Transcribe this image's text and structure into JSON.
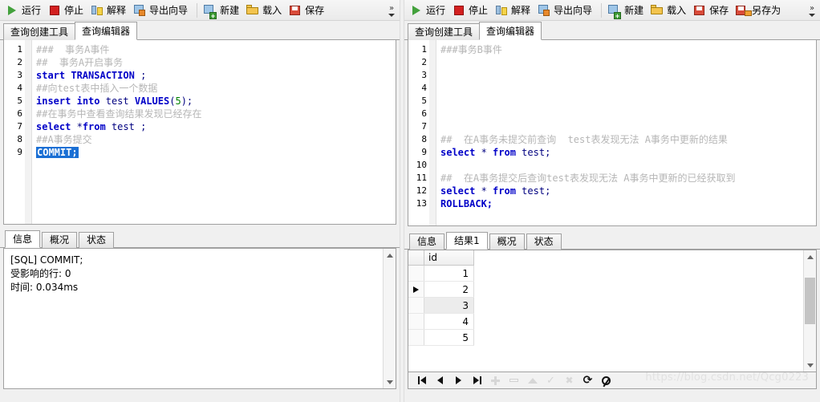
{
  "left_pane": {
    "toolbar": {
      "buttons": [
        {
          "label": "运行",
          "icon": "run-icon"
        },
        {
          "label": "停止",
          "icon": "stop-icon"
        },
        {
          "label": "解释",
          "icon": "explain-icon"
        },
        {
          "label": "导出向导",
          "icon": "export-wizard-icon"
        },
        {
          "label": "新建",
          "icon": "new-icon"
        },
        {
          "label": "载入",
          "icon": "load-folder-icon"
        },
        {
          "label": "保存",
          "icon": "save-floppy-icon"
        }
      ],
      "overflow_label": "»"
    },
    "tabs": [
      {
        "label": "查询创建工具",
        "active": false
      },
      {
        "label": "查询编辑器",
        "active": true
      }
    ],
    "editor": {
      "lines": [
        {
          "n": "1",
          "segments": [
            {
              "text": "###  事务A事件",
              "cls": "cm"
            }
          ]
        },
        {
          "n": "2",
          "segments": [
            {
              "text": "##  事务A开启事务",
              "cls": "cm"
            }
          ]
        },
        {
          "n": "3",
          "segments": [
            {
              "text": "start",
              "cls": "kw"
            },
            {
              "text": " ",
              "cls": ""
            },
            {
              "text": "TRANSACTION",
              "cls": "kw"
            },
            {
              "text": " ;",
              "cls": "id2"
            }
          ]
        },
        {
          "n": "4",
          "segments": [
            {
              "text": "##向test表中插入一个数据",
              "cls": "cm"
            }
          ]
        },
        {
          "n": "5",
          "segments": [
            {
              "text": "insert",
              "cls": "kw"
            },
            {
              "text": " ",
              "cls": ""
            },
            {
              "text": "into",
              "cls": "kw"
            },
            {
              "text": " test ",
              "cls": "id2"
            },
            {
              "text": "VALUES",
              "cls": "kw"
            },
            {
              "text": "(",
              "cls": "id2"
            },
            {
              "text": "5",
              "cls": "num"
            },
            {
              "text": ");",
              "cls": "id2"
            }
          ]
        },
        {
          "n": "6",
          "segments": [
            {
              "text": "##在事务中查看查询结果发现已经存在",
              "cls": "cm"
            }
          ]
        },
        {
          "n": "7",
          "segments": [
            {
              "text": "select",
              "cls": "kw"
            },
            {
              "text": " *",
              "cls": "id2"
            },
            {
              "text": "from",
              "cls": "kw"
            },
            {
              "text": " test ;",
              "cls": "id2"
            }
          ]
        },
        {
          "n": "8",
          "segments": [
            {
              "text": "##A事务提交",
              "cls": "cm"
            }
          ]
        },
        {
          "n": "9",
          "segments": [
            {
              "text": "COMMIT;",
              "cls": "sel"
            }
          ]
        }
      ]
    },
    "bottom_tabs": [
      {
        "label": "信息",
        "active": true
      },
      {
        "label": "概况",
        "active": false
      },
      {
        "label": "状态",
        "active": false
      }
    ],
    "info_lines": [
      "[SQL] COMMIT;",
      "受影响的行: 0",
      "时间: 0.034ms"
    ]
  },
  "right_pane": {
    "toolbar": {
      "buttons": [
        {
          "label": "运行",
          "icon": "run-icon"
        },
        {
          "label": "停止",
          "icon": "stop-icon"
        },
        {
          "label": "解释",
          "icon": "explain-icon"
        },
        {
          "label": "导出向导",
          "icon": "export-wizard-icon"
        },
        {
          "label": "新建",
          "icon": "new-icon"
        },
        {
          "label": "载入",
          "icon": "load-folder-icon"
        },
        {
          "label": "保存",
          "icon": "save-floppy-icon"
        },
        {
          "label": "另存为",
          "icon": "save-as-icon"
        }
      ],
      "overflow_label": "»"
    },
    "tabs": [
      {
        "label": "查询创建工具",
        "active": false
      },
      {
        "label": "查询编辑器",
        "active": true
      }
    ],
    "editor": {
      "lines": [
        {
          "n": "1",
          "segments": [
            {
              "text": "###事务B事件",
              "cls": "cm"
            }
          ]
        },
        {
          "n": "2",
          "segments": [
            {
              "text": "",
              "cls": ""
            }
          ]
        },
        {
          "n": "3",
          "segments": [
            {
              "text": "",
              "cls": ""
            }
          ]
        },
        {
          "n": "4",
          "segments": [
            {
              "text": "",
              "cls": ""
            }
          ]
        },
        {
          "n": "5",
          "segments": [
            {
              "text": "",
              "cls": ""
            }
          ]
        },
        {
          "n": "6",
          "segments": [
            {
              "text": "",
              "cls": ""
            }
          ]
        },
        {
          "n": "7",
          "segments": [
            {
              "text": "",
              "cls": ""
            }
          ]
        },
        {
          "n": "8",
          "segments": [
            {
              "text": "##  在A事务未提交前查询  test表发现无法 A事务中更新的结果",
              "cls": "cm"
            }
          ]
        },
        {
          "n": "9",
          "segments": [
            {
              "text": "select",
              "cls": "kw"
            },
            {
              "text": " * ",
              "cls": "id2"
            },
            {
              "text": "from",
              "cls": "kw"
            },
            {
              "text": " test;",
              "cls": "id2"
            }
          ]
        },
        {
          "n": "10",
          "segments": [
            {
              "text": "",
              "cls": ""
            }
          ]
        },
        {
          "n": "11",
          "segments": [
            {
              "text": "##  在A事务提交后查询test表发现无法 A事务中更新的已经获取到",
              "cls": "cm"
            }
          ]
        },
        {
          "n": "12",
          "segments": [
            {
              "text": "select",
              "cls": "kw"
            },
            {
              "text": " * ",
              "cls": "id2"
            },
            {
              "text": "from",
              "cls": "kw"
            },
            {
              "text": " test;",
              "cls": "id2"
            }
          ]
        },
        {
          "n": "13",
          "segments": [
            {
              "text": "ROLLBACK;",
              "cls": "kw"
            }
          ]
        }
      ]
    },
    "bottom_tabs": [
      {
        "label": "信息",
        "active": false
      },
      {
        "label": "结果1",
        "active": true
      },
      {
        "label": "概况",
        "active": false
      },
      {
        "label": "状态",
        "active": false
      }
    ],
    "result_grid": {
      "columns": [
        "id"
      ],
      "rows": [
        {
          "id": "1",
          "current": false,
          "highlighted": false
        },
        {
          "id": "2",
          "current": true,
          "highlighted": false
        },
        {
          "id": "3",
          "current": false,
          "highlighted": true
        },
        {
          "id": "4",
          "current": false,
          "highlighted": false
        },
        {
          "id": "5",
          "current": false,
          "highlighted": false
        }
      ]
    },
    "nav_buttons": [
      {
        "name": "first-record",
        "enabled": true
      },
      {
        "name": "prev-record",
        "enabled": true
      },
      {
        "name": "next-record",
        "enabled": true
      },
      {
        "name": "last-record",
        "enabled": true
      },
      {
        "name": "add-record",
        "enabled": false
      },
      {
        "name": "delete-record",
        "enabled": false
      },
      {
        "name": "edit-record",
        "enabled": false
      },
      {
        "name": "confirm-record",
        "enabled": false
      },
      {
        "name": "cancel-record",
        "enabled": false
      },
      {
        "name": "refresh-record",
        "enabled": true
      },
      {
        "name": "stop-record",
        "enabled": true
      }
    ],
    "watermark": "https://blog.csdn.net/Qcg0223"
  }
}
